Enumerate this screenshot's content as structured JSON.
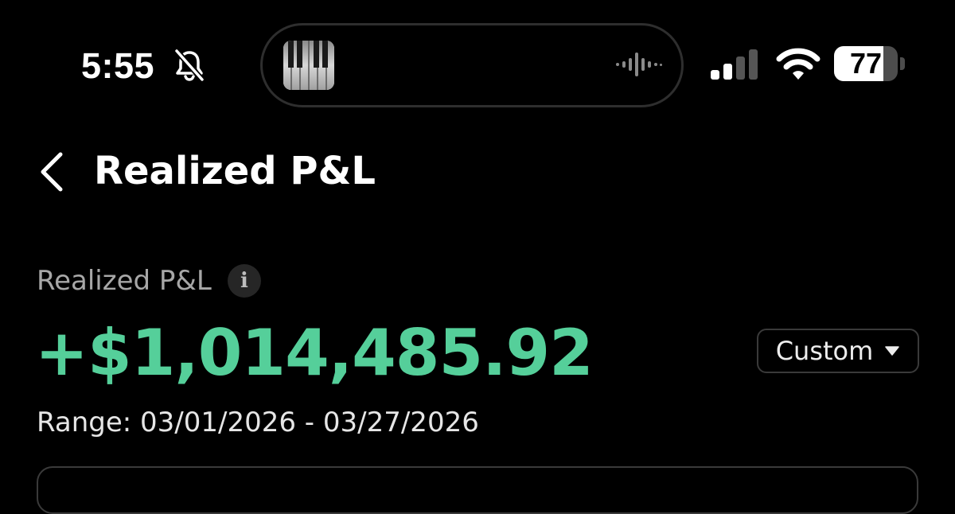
{
  "status_bar": {
    "time": "5:55",
    "battery_level": "77",
    "battery_fraction": 0.77,
    "signal_bars_active": 2,
    "signal_bars_total": 4
  },
  "header": {
    "title": "Realized P&L"
  },
  "summary": {
    "label": "Realized P&L",
    "info_icon": "i",
    "amount": "+$1,014,485.92",
    "range": "Range: 03/01/2026 - 03/27/2026"
  },
  "filter": {
    "selected": "Custom"
  },
  "colors": {
    "background": "#000000",
    "positive": "#55cf9a",
    "muted_text": "#a7a7a7"
  },
  "icons": {
    "back": "chevron-left-icon",
    "bell": "bell-slash-icon",
    "wifi": "wifi-icon",
    "signal": "cellular-signal-icon",
    "waveform": "audio-waveform-icon",
    "info": "info-icon",
    "caret": "caret-down-icon"
  }
}
